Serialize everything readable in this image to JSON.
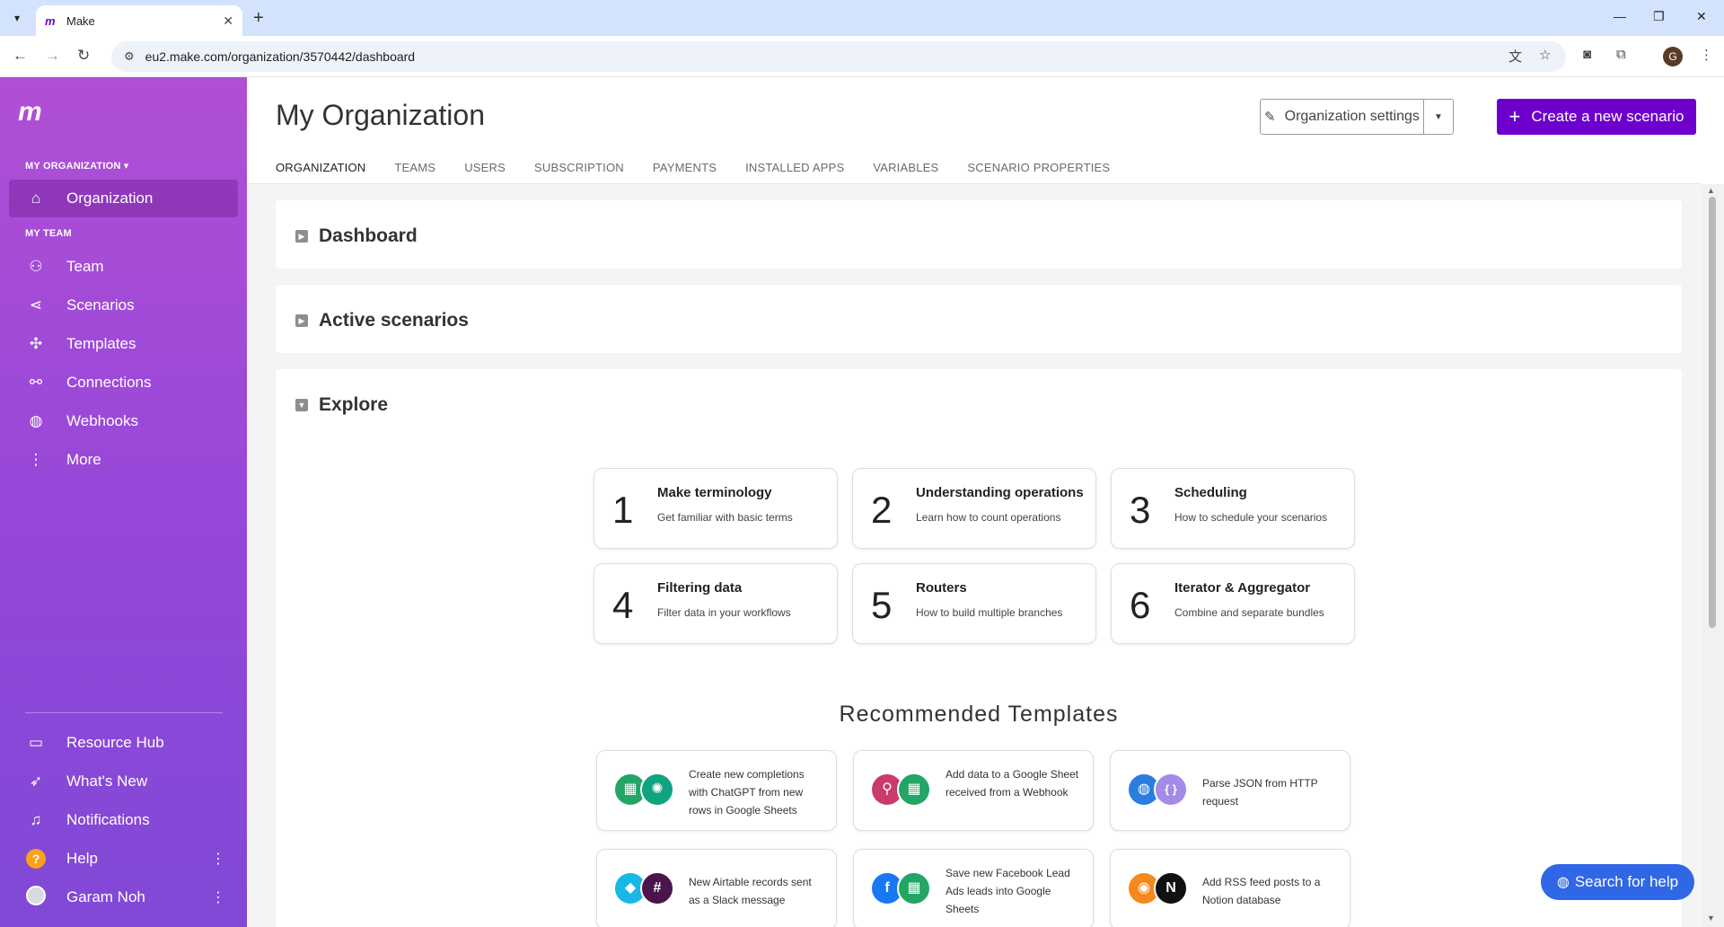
{
  "browser": {
    "tab_title": "Make",
    "favicon_text": "m",
    "url": "eu2.make.com/organization/3570442/dashboard",
    "profile_initial": "G"
  },
  "sidebar": {
    "logo_text": "m",
    "org_section": "MY ORGANIZATION ▾",
    "team_section": "MY TEAM",
    "org_item": {
      "label": "Organization",
      "icon": "home-icon"
    },
    "team_items": [
      {
        "label": "Team",
        "icon": "team-icon"
      },
      {
        "label": "Scenarios",
        "icon": "share-icon"
      },
      {
        "label": "Templates",
        "icon": "puzzle-icon"
      },
      {
        "label": "Connections",
        "icon": "link-icon"
      },
      {
        "label": "Webhooks",
        "icon": "globe-icon"
      },
      {
        "label": "More",
        "icon": "more-icon"
      }
    ],
    "bottom_items": [
      {
        "label": "Resource Hub",
        "icon": "book-icon"
      },
      {
        "label": "What's New",
        "icon": "rocket-icon"
      },
      {
        "label": "Notifications",
        "icon": "bell-icon"
      },
      {
        "label": "Help",
        "icon": "help-icon"
      },
      {
        "label": "Garam Noh",
        "icon": "avatar"
      }
    ]
  },
  "header": {
    "title": "My Organization",
    "settings_label": "Organization settings",
    "create_label": "Create a new scenario",
    "tabs": [
      "ORGANIZATION",
      "TEAMS",
      "USERS",
      "SUBSCRIPTION",
      "PAYMENTS",
      "INSTALLED APPS",
      "VARIABLES",
      "SCENARIO PROPERTIES"
    ],
    "active_tab": "ORGANIZATION"
  },
  "panels": {
    "dashboard": "Dashboard",
    "active": "Active scenarios",
    "explore": "Explore"
  },
  "steps": [
    {
      "num": "1",
      "title": "Make terminology",
      "desc": "Get familiar with basic terms"
    },
    {
      "num": "2",
      "title": "Understanding operations",
      "desc": "Learn how to count operations"
    },
    {
      "num": "3",
      "title": "Scheduling",
      "desc": "How to schedule your scenarios"
    },
    {
      "num": "4",
      "title": "Filtering data",
      "desc": "Filter data in your workflows"
    },
    {
      "num": "5",
      "title": "Routers",
      "desc": "How to build multiple branches"
    },
    {
      "num": "6",
      "title": "Iterator & Aggregator",
      "desc": "Combine and separate bundles"
    }
  ],
  "recommended": {
    "title": "Recommended Templates",
    "templates": [
      {
        "text": "Create new completions with ChatGPT from new rows in Google Sheets",
        "apps": [
          {
            "glyph": "▦",
            "color": "#23a566"
          },
          {
            "glyph": "✺",
            "color": "#10a37f"
          }
        ]
      },
      {
        "text": "Add data to a Google Sheet received from a Webhook",
        "apps": [
          {
            "glyph": "⚲",
            "color": "#c93c6a"
          },
          {
            "glyph": "▦",
            "color": "#23a566"
          }
        ]
      },
      {
        "text": "Parse JSON from HTTP request",
        "apps": [
          {
            "glyph": "◍",
            "color": "#2b7de0"
          },
          {
            "glyph": "{ }",
            "color": "#a48be8"
          }
        ]
      },
      {
        "text": "New Airtable records sent as a Slack message",
        "apps": [
          {
            "glyph": "◆",
            "color": "#18b7e6"
          },
          {
            "glyph": "#",
            "color": "#4a154b"
          }
        ]
      },
      {
        "text": "Save new Facebook Lead Ads leads into Google Sheets",
        "apps": [
          {
            "glyph": "f",
            "color": "#1877f2"
          },
          {
            "glyph": "▦",
            "color": "#23a566"
          }
        ]
      },
      {
        "text": "Add RSS feed posts to a Notion database",
        "apps": [
          {
            "glyph": "◉",
            "color": "#f5891f"
          },
          {
            "glyph": "N",
            "color": "#111111"
          }
        ]
      }
    ]
  },
  "help_button": "Search for help",
  "colors": {
    "accent": "#6d00cc",
    "help": "#2f67e6"
  }
}
